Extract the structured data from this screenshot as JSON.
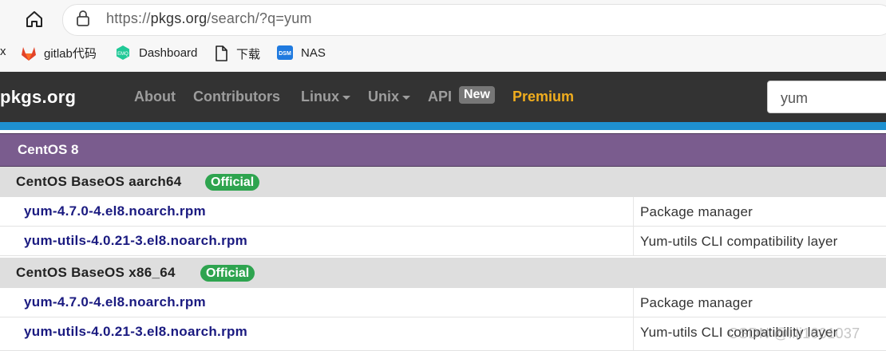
{
  "browser": {
    "url_prefix": "https://",
    "url_host": "pkgs.org",
    "url_path": "/search/?q=yum",
    "bookmarks": {
      "partial": "x",
      "gitlab": "gitlab代码",
      "dashboard": "Dashboard",
      "download": "下载",
      "nas": "NAS"
    }
  },
  "site": {
    "brand": "pkgs.org",
    "nav": {
      "about": "About",
      "contributors": "Contributors",
      "linux": "Linux",
      "unix": "Unix",
      "api": "API",
      "api_badge": "New",
      "premium": "Premium"
    },
    "search_value": "yum"
  },
  "results": {
    "os_title": "CentOS 8",
    "official_label": "Official",
    "repo1": {
      "name": "CentOS BaseOS aarch64",
      "pkg1": {
        "name": "yum-4.7.0-4.el8.noarch.rpm",
        "desc": "Package manager"
      },
      "pkg2": {
        "name": "yum-utils-4.0.21-3.el8.noarch.rpm",
        "desc": "Yum-utils CLI compatibility layer"
      }
    },
    "repo2": {
      "name": "CentOS BaseOS x86_64",
      "pkg1": {
        "name": "yum-4.7.0-4.el8.noarch.rpm",
        "desc": "Package manager"
      },
      "pkg2": {
        "name": "yum-utils-4.0.21-3.el8.noarch.rpm",
        "desc": "Yum-utils CLI compatibility layer"
      }
    }
  },
  "watermark": "CSDN @lili1001037",
  "colors": {
    "navbar": "#333333",
    "accent_strip": "#1e90d0",
    "os_header": "#7a5c8e",
    "official_badge": "#2ea44f",
    "premium": "#f0ad1e",
    "link": "#1a1a80"
  }
}
